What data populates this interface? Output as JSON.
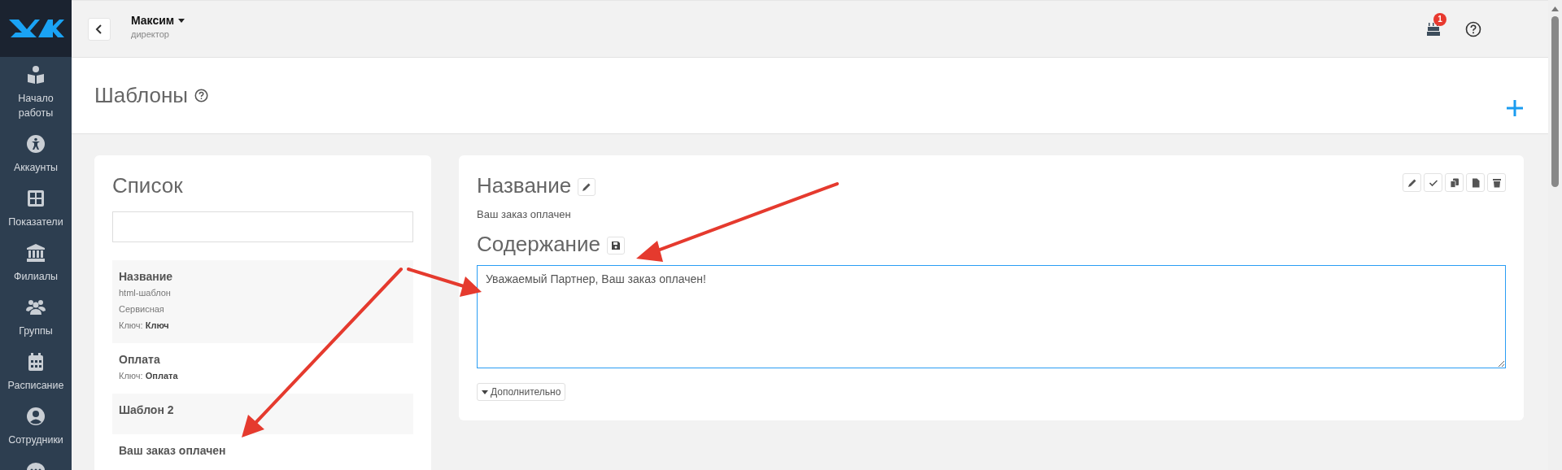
{
  "sidebar": {
    "items": [
      {
        "label": "Начало работы"
      },
      {
        "label": "Аккаунты"
      },
      {
        "label": "Показатели"
      },
      {
        "label": "Филиалы"
      },
      {
        "label": "Группы"
      },
      {
        "label": "Расписание"
      },
      {
        "label": "Сотрудники"
      }
    ]
  },
  "header": {
    "user_name": "Максим",
    "user_role": "директор",
    "notification_badge": "1"
  },
  "page": {
    "title": "Шаблоны"
  },
  "list_panel": {
    "title": "Список",
    "items": [
      {
        "title": "Название",
        "lines": [
          "html-шаблон",
          "Сервисная",
          "Ключ: **Ключ**"
        ]
      },
      {
        "title": "Оплата",
        "lines": [
          "Ключ: **Оплата**"
        ]
      },
      {
        "title": "Шаблон 2"
      },
      {
        "title": "Ваш заказ оплачен"
      }
    ]
  },
  "detail": {
    "name_heading": "Название",
    "name_value": "Ваш заказ оплачен",
    "content_heading": "Содержание",
    "content_value": "Уважаемый Партнер, Ваш заказ оплачен!",
    "content_focused": true,
    "more_button": "Дополнительно"
  }
}
